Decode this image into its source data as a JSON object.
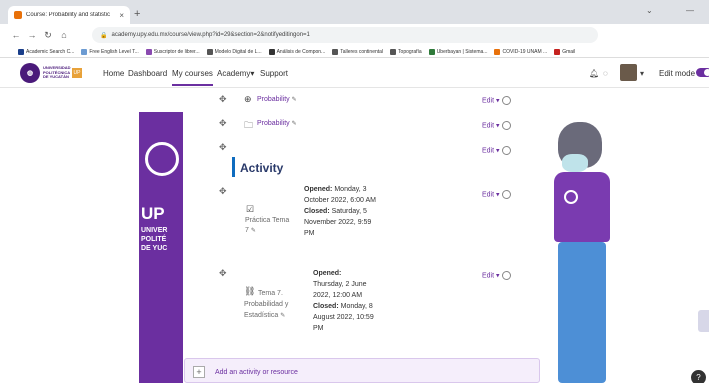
{
  "browser": {
    "tab_title": "Course: Probability and statistic",
    "tab_close": "×",
    "new_tab": "+",
    "url": "academy.upy.edu.mx/course/view.php?id=29&section=2&notifyeditingon=1",
    "bookmarks": [
      {
        "label": "Academic Search C...",
        "color": "#1a3e8a"
      },
      {
        "label": "Free English Level T...",
        "color": "#6c9bd2"
      },
      {
        "label": "Suscriptor de librer...",
        "color": "#8a4ab0"
      },
      {
        "label": "Modelo Digital de L...",
        "color": "#555555"
      },
      {
        "label": "Análisis de Compon...",
        "color": "#333333"
      },
      {
        "label": "Talleres continental",
        "color": "#555555"
      },
      {
        "label": "Topografía",
        "color": "#555555"
      },
      {
        "label": "Uberbayan | Sistema...",
        "color": "#2f7a3a"
      },
      {
        "label": "COVID-19 UNAM ...",
        "color": "#e8710a"
      },
      {
        "label": "Gmail",
        "color": "#c5221f"
      }
    ]
  },
  "navbar": {
    "logo_text": "UNIVERSIDAD POLITÉCNICA DE YUCATÁN",
    "logo_badge": "UP",
    "links": [
      "Home",
      "Dashboard",
      "My courses",
      "Academy",
      "Support"
    ],
    "academy_caret": "▾",
    "edit_mode_label": "Edit mode"
  },
  "banner": {
    "up": "UP",
    "sub": [
      "UNIVER",
      "POLITÉ",
      "DE YUC"
    ]
  },
  "content": {
    "edit_label": "Edit",
    "edit_caret": "▾",
    "rows": [
      {
        "label": "Probability",
        "icon": "globe-icon"
      },
      {
        "label": "Probability",
        "icon": "folder-icon"
      }
    ],
    "section_title": "Activity",
    "assignment": {
      "name": "Práctica Tema 7",
      "opened_label": "Opened:",
      "opened_value": "Monday, 3 October 2022, 6:00 AM",
      "closed_label": "Closed:",
      "closed_value": "Saturday, 5 November 2022, 9:59 PM"
    },
    "quiz": {
      "name": "Tema 7. Probabilidad y Estadística",
      "opened_label": "Opened:",
      "opened_value": "Thursday, 2 June 2022, 12:00 AM",
      "closed_label": "Closed:",
      "closed_value": "Monday, 8 August 2022, 10:59 PM"
    },
    "add_activity": "Add an activity or resource"
  },
  "help_label": "?",
  "colors": {
    "accent": "#6b2fa0",
    "section_bar": "#0f6cbf"
  }
}
